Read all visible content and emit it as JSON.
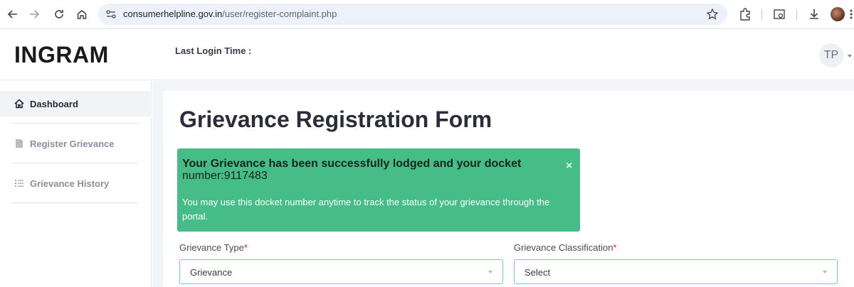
{
  "browser": {
    "url_domain": "consumerhelpline.gov.in",
    "url_path": "/user/register-complaint.php"
  },
  "header": {
    "logo": "INGRAM",
    "last_login_label": "Last Login Time :",
    "avatar_initials": "TP"
  },
  "sidebar": {
    "items": [
      {
        "label": "Dashboard",
        "icon": "home-icon",
        "active": true
      },
      {
        "label": "Register Grievance",
        "icon": "document-icon",
        "active": false
      },
      {
        "label": "Grievance History",
        "icon": "list-icon",
        "active": false
      }
    ]
  },
  "main": {
    "title": "Grievance Registration Form",
    "alert": {
      "headline": "Your Grievance has been successfully lodged and your docket",
      "docket_line": "number:9117483",
      "message": "You may use this docket number anytime to track the status of your grievance through the portal.",
      "close_symbol": "×",
      "color": "#46bd87"
    },
    "fields": {
      "grievance_type": {
        "label": "Grievance Type",
        "required_mark": "*",
        "value": "Grievance"
      },
      "grievance_classification": {
        "label": "Grievance Classification",
        "required_mark": "*",
        "value": "Select"
      }
    }
  },
  "colors": {
    "accent_border": "#6fc9e9",
    "success": "#46bd87",
    "required": "#e02424"
  }
}
